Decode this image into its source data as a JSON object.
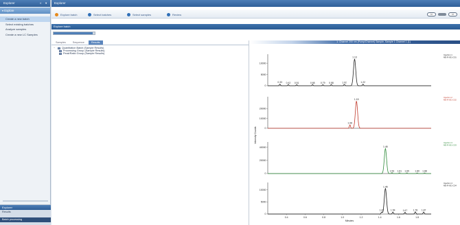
{
  "nav": {
    "title": "Explorer",
    "subheader": "Explore",
    "items": [
      "Create a new batch",
      "Select existing batches",
      "Analyze samples",
      "Create a new LC Samples"
    ],
    "bottom_header": "Explorer",
    "bottom_item": "Results",
    "bottom_item_dark": "Batch processing"
  },
  "main": {
    "title": "Explorer",
    "panel_title": "Explore batch",
    "progress": 0.95
  },
  "breadcrumb": [
    {
      "label": "Explore batch",
      "color": "orange"
    },
    {
      "label": "Select batches",
      "color": "blue"
    },
    {
      "label": "Select samples",
      "color": "blue"
    },
    {
      "label": "Review",
      "color": "blue"
    }
  ],
  "nav_buttons": {
    "prev": "Prev",
    "next": "Next"
  },
  "tree": {
    "tabs": [
      "Samples",
      "Sequence",
      "Results"
    ],
    "active_tab": 2,
    "rows": [
      {
        "indent": 0,
        "toggle": "−",
        "label": "Quantitation Batch (Sample Results)"
      },
      {
        "indent": 1,
        "toggle": "",
        "label": "Processing Group (Sample Results)"
      },
      {
        "indent": 1,
        "toggle": "",
        "label": "Peak/Ratio Group (Sample Results)"
      }
    ]
  },
  "chromatogram": {
    "title": "1: Channel 200 nm (Pump/Channel) Sample, Sample 1 Channel 1 (1)",
    "side_labels": [
      [
        "Injection 1",
        "ME-R-001-C01"
      ],
      [
        "Injection 2",
        "ME-R-001-C02"
      ],
      [
        "Injection 3",
        "ME-R-001-C03"
      ],
      [
        "Injection 4",
        "ME-R-001-C04"
      ]
    ]
  },
  "colors": {
    "accent": "#2f5f98",
    "trace1": "#222222",
    "trace2": "#c0392b",
    "trace3": "#2e8b3a",
    "trace4": "#1a1a1a"
  },
  "chart_data": {
    "type": "line",
    "xlabel": "Minutes",
    "ylabel": "Intensity Counts",
    "x_ticks": [
      "0.4",
      "0.6",
      "0.8",
      "1.0",
      "1.2",
      "1.4",
      "1.6",
      "1.8"
    ],
    "xlim": [
      0.2,
      1.95
    ],
    "panels": [
      {
        "y_ticks": [
          "10000",
          "5000",
          "0"
        ],
        "ylim": [
          0,
          14000
        ],
        "peaks": [
          {
            "x": 1.13,
            "y": 11800,
            "label": "1.13"
          },
          {
            "x": 0.33,
            "y": 700,
            "label": "0.33"
          },
          {
            "x": 0.42,
            "y": 500,
            "label": "0.42"
          },
          {
            "x": 0.51,
            "y": 450,
            "label": "0.51"
          },
          {
            "x": 0.68,
            "y": 500,
            "label": "0.68"
          },
          {
            "x": 0.79,
            "y": 450,
            "label": "0.79"
          },
          {
            "x": 0.88,
            "y": 500,
            "label": "0.88"
          },
          {
            "x": 1.02,
            "y": 600,
            "label": "1.02"
          },
          {
            "x": 1.22,
            "y": 700,
            "label": "1.22"
          }
        ]
      },
      {
        "y_ticks": [
          "20000",
          "10000",
          "0"
        ],
        "ylim": [
          0,
          32000
        ],
        "peaks": [
          {
            "x": 1.15,
            "y": 27500,
            "label": "1.15"
          },
          {
            "x": 1.08,
            "y": 3500,
            "label": "1.08"
          }
        ]
      },
      {
        "y_ticks": [
          "40000",
          "20000",
          "0"
        ],
        "ylim": [
          0,
          48000
        ],
        "peaks": [
          {
            "x": 1.46,
            "y": 38000,
            "label": "1.46"
          },
          {
            "x": 1.53,
            "y": 1200,
            "label": "1.53"
          },
          {
            "x": 1.61,
            "y": 1000,
            "label": "1.61"
          },
          {
            "x": 1.69,
            "y": 1000,
            "label": "1.69"
          },
          {
            "x": 1.8,
            "y": 900,
            "label": "1.80"
          },
          {
            "x": 1.88,
            "y": 900,
            "label": "1.88"
          }
        ]
      },
      {
        "y_ticks": [
          "10000",
          "5000",
          "0"
        ],
        "ylim": [
          0,
          13000
        ],
        "peaks": [
          {
            "x": 1.46,
            "y": 10500,
            "label": "1.46"
          },
          {
            "x": 1.42,
            "y": 800,
            "label": "1.42"
          },
          {
            "x": 1.54,
            "y": 800,
            "label": "1.54"
          },
          {
            "x": 1.67,
            "y": 700,
            "label": "1.67"
          },
          {
            "x": 1.78,
            "y": 900,
            "label": "1.78"
          },
          {
            "x": 1.87,
            "y": 800,
            "label": "1.87"
          }
        ]
      }
    ]
  }
}
